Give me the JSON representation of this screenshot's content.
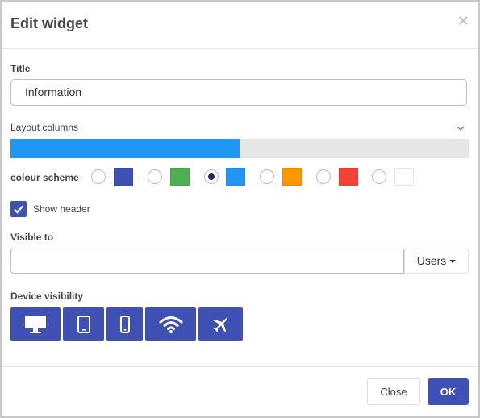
{
  "dialog": {
    "title": "Edit widget",
    "close_icon": "close-icon"
  },
  "title_field": {
    "label": "Title",
    "value": "Information"
  },
  "layout": {
    "label": "Layout columns",
    "fraction": 0.5,
    "fill_color": "#2196f3",
    "track_color": "#e6e6e6"
  },
  "colour_scheme": {
    "label": "colour scheme",
    "selected_index": 2,
    "options": [
      "#3f51b5",
      "#4caf50",
      "#2196f3",
      "#ff9800",
      "#f44336",
      "#ffffff"
    ]
  },
  "show_header": {
    "label": "Show header",
    "checked": true
  },
  "visible_to": {
    "label": "Visible to",
    "value": "",
    "dropdown_label": "Users"
  },
  "device_visibility": {
    "label": "Device visibility",
    "devices": [
      "desktop-icon",
      "tablet-icon",
      "phone-icon",
      "wifi-icon",
      "airplane-icon"
    ],
    "color": "#3f51b5"
  },
  "footer": {
    "close_label": "Close",
    "ok_label": "OK"
  }
}
